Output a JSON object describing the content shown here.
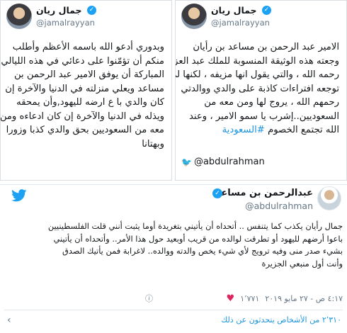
{
  "left_panel": {
    "name": "جمال ريان",
    "handle": "@jamalrayyan",
    "lines": [
      "وبدوري أدعو الله باسمه الأعظم وأطلب",
      "منكم أن تؤمّنوا على دعائي في هذه الليالي",
      "المباركة أن يوفق الامير عبد الرحمن بن",
      "مساعد ويعلي منزلته في الدنيا والآخرة إن",
      "كان والدي با ع ارضه لليهود,وأن يمحقه",
      "ويذله في الدنيا والآخرة إن كان ادعاءه ومن",
      "معه من السعوديين بحق والدي كذبا وزورا",
      "وبهتانا"
    ]
  },
  "right_panel": {
    "name": "جمال ريان",
    "handle": "@jamalrayyan",
    "lines": [
      "الامير عبد الرحمن بن مساعد بن رأيان",
      "وجعته هذه الوثيقة المنسوبة للملك عبد العزيز",
      "رحمه الله ، والتي يقول انها مزيفه ، لكنها لم",
      "توجعه افتراءات كاذبة على والدي ووالدتي",
      "رحمهم الله ، يروج لها ومن معه من",
      "السعوديين..إشرب يا سمو الامير ، وعند",
      "الله تجتمع الخصوم"
    ],
    "hashtag": "#السعودية",
    "watermark": "@abdulrahman"
  },
  "tweet": {
    "name": "عبدالرحمن بن مساعد",
    "handle": "@abdulrahman",
    "lines": [
      "جمال رأيان يكذب كما يتنفس .. أتحداه أن يأتيني بتغريدة أوما يثبت أنني قلت الفلسطينيين",
      "باعوا أرضهم لليهود أو تطرقت لوالده من قريب أوبعيد حول هذا الأمر.. وأتحداه أن يأتيني",
      "بشيء صدر منى وفيه ترويج لأي شيء يخص والدته ووالده.. لاغرابة فمن يأتيك الصدق",
      "وأنت أول منبعي الجزيرة"
    ],
    "likes": "١٬٧٧١",
    "time": "٤:١٧ ص - ٢٧ مايو ٢٠١٩",
    "footer": "٢٬٣١٠ من الأشخاص يتحدثون عن ذلك"
  },
  "colors": {
    "twitter_blue": "#1da1f2",
    "link_blue": "#1b95e0",
    "heart_red": "#e0245e",
    "muted_gray": "#657786"
  },
  "icons": {
    "verified": "check-badge",
    "bird": "twitter-bird",
    "heart": "heart",
    "info": "info-circle",
    "chevron": "chevron"
  }
}
